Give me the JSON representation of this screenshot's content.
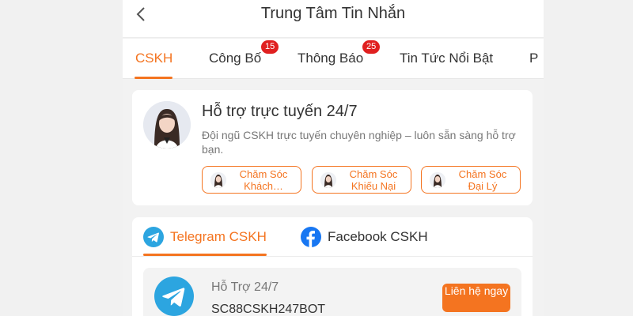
{
  "header": {
    "title": "Trung Tâm Tin Nhắn"
  },
  "tabs": [
    {
      "label": "CSKH",
      "badge": ""
    },
    {
      "label": "Công Bố",
      "badge": "15"
    },
    {
      "label": "Thông Báo",
      "badge": "25"
    },
    {
      "label": "Tin Tức Nổi Bật",
      "badge": ""
    },
    {
      "label": "P",
      "badge": ""
    }
  ],
  "support": {
    "title": "Hỗ trợ trực tuyến 24/7",
    "description": "Đội ngũ CSKH trực tuyến chuyên nghiệp – luôn sẵn sàng hỗ trợ bạn.",
    "chips": [
      {
        "label": "Chăm Sóc Khách…"
      },
      {
        "label": "Chăm Sóc Khiếu Nại"
      },
      {
        "label": "Chăm Sóc Đại Lý"
      }
    ]
  },
  "channels": {
    "tabs": [
      {
        "label": "Telegram CSKH",
        "icon": "telegram-icon"
      },
      {
        "label": "Facebook CSKH",
        "icon": "facebook-icon"
      }
    ],
    "item": {
      "title": "Hỗ Trợ 24/7",
      "handle": "SC88CSKH247BOT",
      "button": "Liên hệ ngay"
    }
  },
  "colors": {
    "accent": "#f47420",
    "badge": "#e02020",
    "telegram": "#2ca5e0",
    "facebook": "#1877f2"
  }
}
